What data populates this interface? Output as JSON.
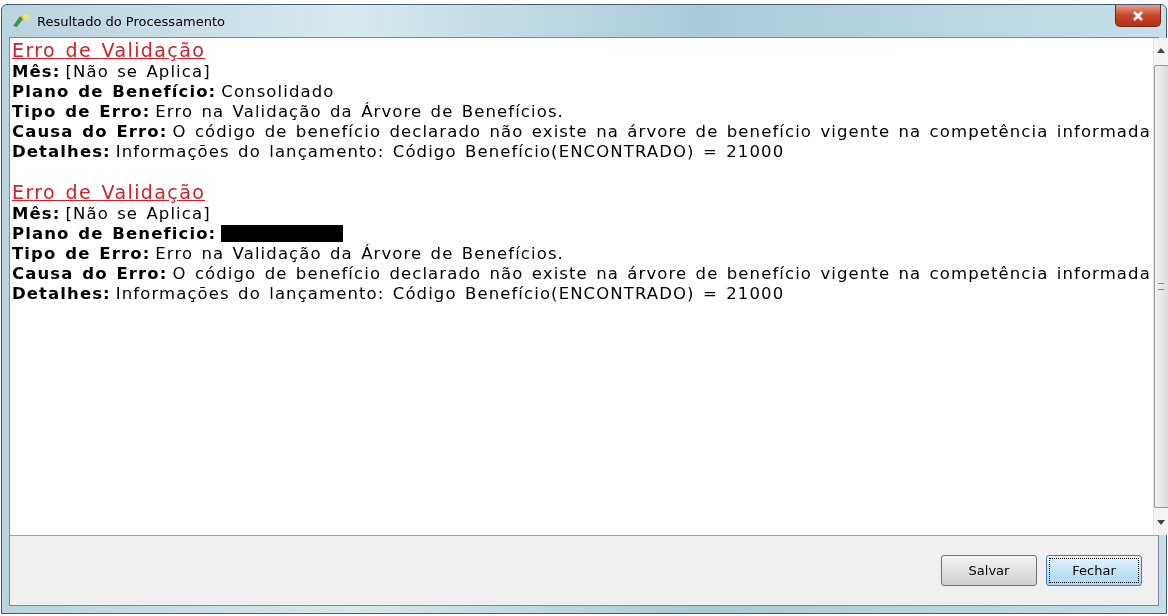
{
  "window": {
    "title": "Resultado do Processamento"
  },
  "errors": [
    {
      "heading": "Erro de Validação",
      "fields": [
        {
          "label": "Mês:",
          "value": "[Não se Aplica]"
        },
        {
          "label": "Plano de Benefício:",
          "value": "Consolidado"
        },
        {
          "label": "Tipo de Erro:",
          "value": "Erro na Validação da Árvore de Benefícios."
        },
        {
          "label": "Causa do Erro:",
          "value": "O código de benefício declarado não existe na árvore de benefício vigente na competência informada"
        },
        {
          "label": "Detalhes:",
          "value": "Informações do lançamento: Código Benefício(ENCONTRADO) = 21000"
        }
      ]
    },
    {
      "heading": "Erro de Validação",
      "fields": [
        {
          "label": "Mês:",
          "value": "[Não se Aplica]"
        },
        {
          "label": "Plano de Beneficio:",
          "redacted": true
        },
        {
          "label": "Tipo de Erro:",
          "value": "Erro na Validação da Árvore de Benefícios."
        },
        {
          "label": "Causa do Erro:",
          "value": "O código de benefício declarado não existe na árvore de benefício vigente na competência informada"
        },
        {
          "label": "Detalhes:",
          "value": "Informações do lançamento: Código Benefício(ENCONTRADO) = 21000"
        }
      ]
    }
  ],
  "buttons": [
    {
      "label": "Salvar",
      "default": false
    },
    {
      "label": "Fechar",
      "default": true
    }
  ]
}
